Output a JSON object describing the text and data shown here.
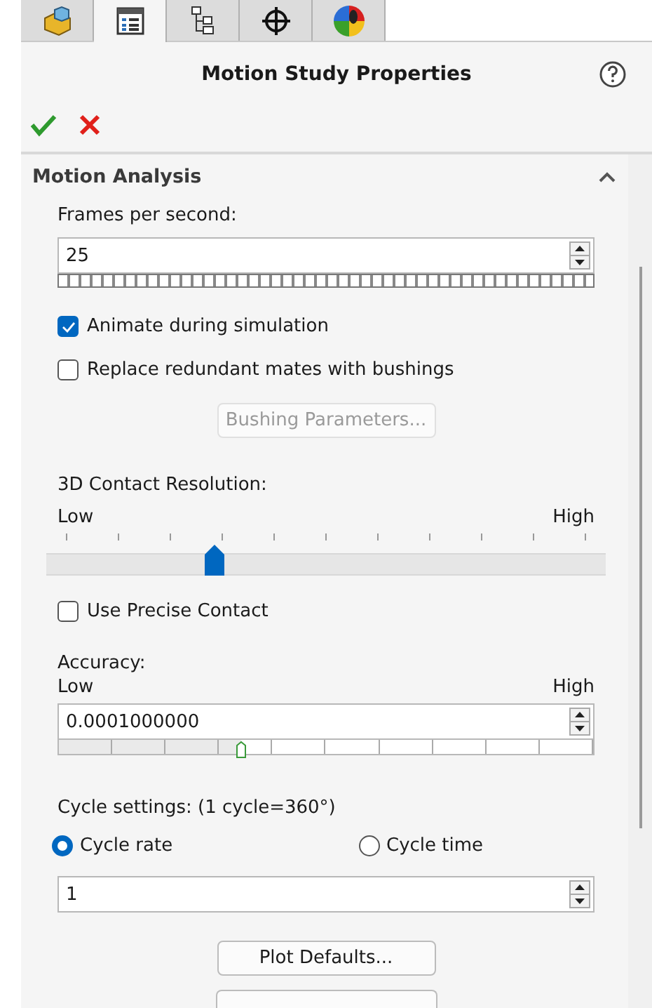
{
  "tabs": [
    {
      "kind": "part",
      "selected": false
    },
    {
      "kind": "list",
      "selected": true
    },
    {
      "kind": "tree",
      "selected": false
    },
    {
      "kind": "crosshair",
      "selected": false
    },
    {
      "kind": "appearance",
      "selected": false
    }
  ],
  "panel": {
    "title": "Motion Study Properties"
  },
  "section": {
    "title": "Motion Analysis",
    "expanded": true
  },
  "frames": {
    "label": "Frames per second:",
    "value": "25"
  },
  "options": [
    {
      "label": "Animate during simulation",
      "checked": true
    },
    {
      "label": "Replace redundant mates with bushings",
      "checked": false
    }
  ],
  "bushing_button": {
    "label": "Bushing Parameters...",
    "disabled": true
  },
  "contact": {
    "label": "3D Contact Resolution:",
    "low": "Low",
    "high": "High",
    "level": 0.3
  },
  "precise": {
    "label": "Use Precise Contact",
    "checked": false
  },
  "accuracy": {
    "label": "Accuracy:",
    "low": "Low",
    "high": "High",
    "value": "0.0001000000",
    "level": 0.34
  },
  "cycle": {
    "label": "Cycle settings: (1 cycle=360°)",
    "modes": [
      {
        "label": "Cycle rate",
        "selected": true
      },
      {
        "label": "Cycle time",
        "selected": false
      }
    ],
    "value": "1"
  },
  "plot_button": {
    "label": "Plot Defaults..."
  }
}
